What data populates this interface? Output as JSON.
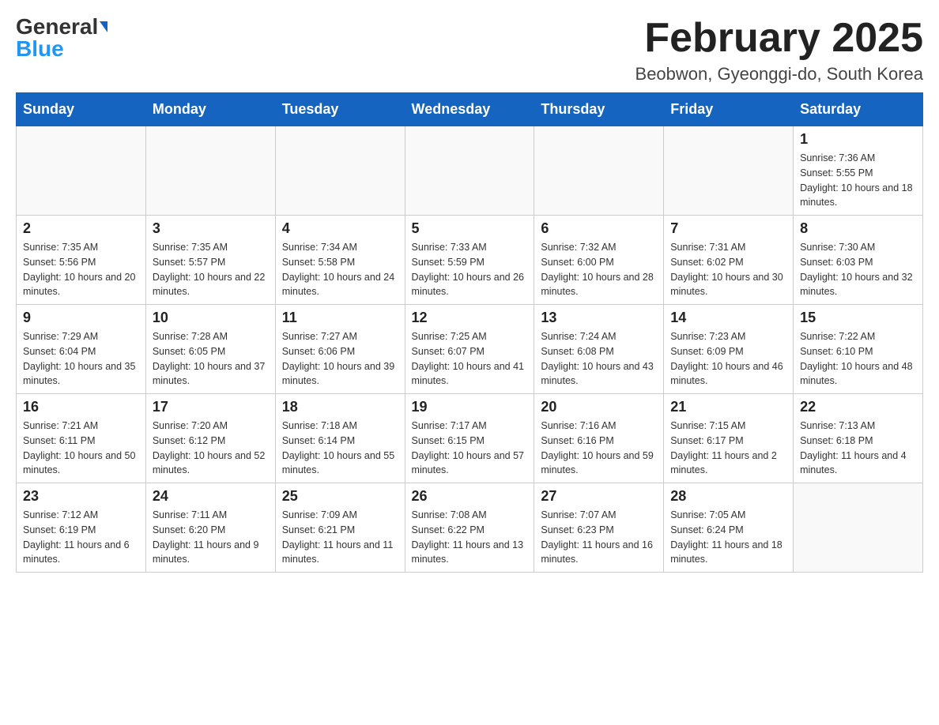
{
  "header": {
    "logo_general": "General",
    "logo_blue": "Blue",
    "month_title": "February 2025",
    "location": "Beobwon, Gyeonggi-do, South Korea"
  },
  "days_of_week": [
    "Sunday",
    "Monday",
    "Tuesday",
    "Wednesday",
    "Thursday",
    "Friday",
    "Saturday"
  ],
  "weeks": [
    [
      {
        "day": "",
        "sunrise": "",
        "sunset": "",
        "daylight": ""
      },
      {
        "day": "",
        "sunrise": "",
        "sunset": "",
        "daylight": ""
      },
      {
        "day": "",
        "sunrise": "",
        "sunset": "",
        "daylight": ""
      },
      {
        "day": "",
        "sunrise": "",
        "sunset": "",
        "daylight": ""
      },
      {
        "day": "",
        "sunrise": "",
        "sunset": "",
        "daylight": ""
      },
      {
        "day": "",
        "sunrise": "",
        "sunset": "",
        "daylight": ""
      },
      {
        "day": "1",
        "sunrise": "Sunrise: 7:36 AM",
        "sunset": "Sunset: 5:55 PM",
        "daylight": "Daylight: 10 hours and 18 minutes."
      }
    ],
    [
      {
        "day": "2",
        "sunrise": "Sunrise: 7:35 AM",
        "sunset": "Sunset: 5:56 PM",
        "daylight": "Daylight: 10 hours and 20 minutes."
      },
      {
        "day": "3",
        "sunrise": "Sunrise: 7:35 AM",
        "sunset": "Sunset: 5:57 PM",
        "daylight": "Daylight: 10 hours and 22 minutes."
      },
      {
        "day": "4",
        "sunrise": "Sunrise: 7:34 AM",
        "sunset": "Sunset: 5:58 PM",
        "daylight": "Daylight: 10 hours and 24 minutes."
      },
      {
        "day": "5",
        "sunrise": "Sunrise: 7:33 AM",
        "sunset": "Sunset: 5:59 PM",
        "daylight": "Daylight: 10 hours and 26 minutes."
      },
      {
        "day": "6",
        "sunrise": "Sunrise: 7:32 AM",
        "sunset": "Sunset: 6:00 PM",
        "daylight": "Daylight: 10 hours and 28 minutes."
      },
      {
        "day": "7",
        "sunrise": "Sunrise: 7:31 AM",
        "sunset": "Sunset: 6:02 PM",
        "daylight": "Daylight: 10 hours and 30 minutes."
      },
      {
        "day": "8",
        "sunrise": "Sunrise: 7:30 AM",
        "sunset": "Sunset: 6:03 PM",
        "daylight": "Daylight: 10 hours and 32 minutes."
      }
    ],
    [
      {
        "day": "9",
        "sunrise": "Sunrise: 7:29 AM",
        "sunset": "Sunset: 6:04 PM",
        "daylight": "Daylight: 10 hours and 35 minutes."
      },
      {
        "day": "10",
        "sunrise": "Sunrise: 7:28 AM",
        "sunset": "Sunset: 6:05 PM",
        "daylight": "Daylight: 10 hours and 37 minutes."
      },
      {
        "day": "11",
        "sunrise": "Sunrise: 7:27 AM",
        "sunset": "Sunset: 6:06 PM",
        "daylight": "Daylight: 10 hours and 39 minutes."
      },
      {
        "day": "12",
        "sunrise": "Sunrise: 7:25 AM",
        "sunset": "Sunset: 6:07 PM",
        "daylight": "Daylight: 10 hours and 41 minutes."
      },
      {
        "day": "13",
        "sunrise": "Sunrise: 7:24 AM",
        "sunset": "Sunset: 6:08 PM",
        "daylight": "Daylight: 10 hours and 43 minutes."
      },
      {
        "day": "14",
        "sunrise": "Sunrise: 7:23 AM",
        "sunset": "Sunset: 6:09 PM",
        "daylight": "Daylight: 10 hours and 46 minutes."
      },
      {
        "day": "15",
        "sunrise": "Sunrise: 7:22 AM",
        "sunset": "Sunset: 6:10 PM",
        "daylight": "Daylight: 10 hours and 48 minutes."
      }
    ],
    [
      {
        "day": "16",
        "sunrise": "Sunrise: 7:21 AM",
        "sunset": "Sunset: 6:11 PM",
        "daylight": "Daylight: 10 hours and 50 minutes."
      },
      {
        "day": "17",
        "sunrise": "Sunrise: 7:20 AM",
        "sunset": "Sunset: 6:12 PM",
        "daylight": "Daylight: 10 hours and 52 minutes."
      },
      {
        "day": "18",
        "sunrise": "Sunrise: 7:18 AM",
        "sunset": "Sunset: 6:14 PM",
        "daylight": "Daylight: 10 hours and 55 minutes."
      },
      {
        "day": "19",
        "sunrise": "Sunrise: 7:17 AM",
        "sunset": "Sunset: 6:15 PM",
        "daylight": "Daylight: 10 hours and 57 minutes."
      },
      {
        "day": "20",
        "sunrise": "Sunrise: 7:16 AM",
        "sunset": "Sunset: 6:16 PM",
        "daylight": "Daylight: 10 hours and 59 minutes."
      },
      {
        "day": "21",
        "sunrise": "Sunrise: 7:15 AM",
        "sunset": "Sunset: 6:17 PM",
        "daylight": "Daylight: 11 hours and 2 minutes."
      },
      {
        "day": "22",
        "sunrise": "Sunrise: 7:13 AM",
        "sunset": "Sunset: 6:18 PM",
        "daylight": "Daylight: 11 hours and 4 minutes."
      }
    ],
    [
      {
        "day": "23",
        "sunrise": "Sunrise: 7:12 AM",
        "sunset": "Sunset: 6:19 PM",
        "daylight": "Daylight: 11 hours and 6 minutes."
      },
      {
        "day": "24",
        "sunrise": "Sunrise: 7:11 AM",
        "sunset": "Sunset: 6:20 PM",
        "daylight": "Daylight: 11 hours and 9 minutes."
      },
      {
        "day": "25",
        "sunrise": "Sunrise: 7:09 AM",
        "sunset": "Sunset: 6:21 PM",
        "daylight": "Daylight: 11 hours and 11 minutes."
      },
      {
        "day": "26",
        "sunrise": "Sunrise: 7:08 AM",
        "sunset": "Sunset: 6:22 PM",
        "daylight": "Daylight: 11 hours and 13 minutes."
      },
      {
        "day": "27",
        "sunrise": "Sunrise: 7:07 AM",
        "sunset": "Sunset: 6:23 PM",
        "daylight": "Daylight: 11 hours and 16 minutes."
      },
      {
        "day": "28",
        "sunrise": "Sunrise: 7:05 AM",
        "sunset": "Sunset: 6:24 PM",
        "daylight": "Daylight: 11 hours and 18 minutes."
      },
      {
        "day": "",
        "sunrise": "",
        "sunset": "",
        "daylight": ""
      }
    ]
  ]
}
